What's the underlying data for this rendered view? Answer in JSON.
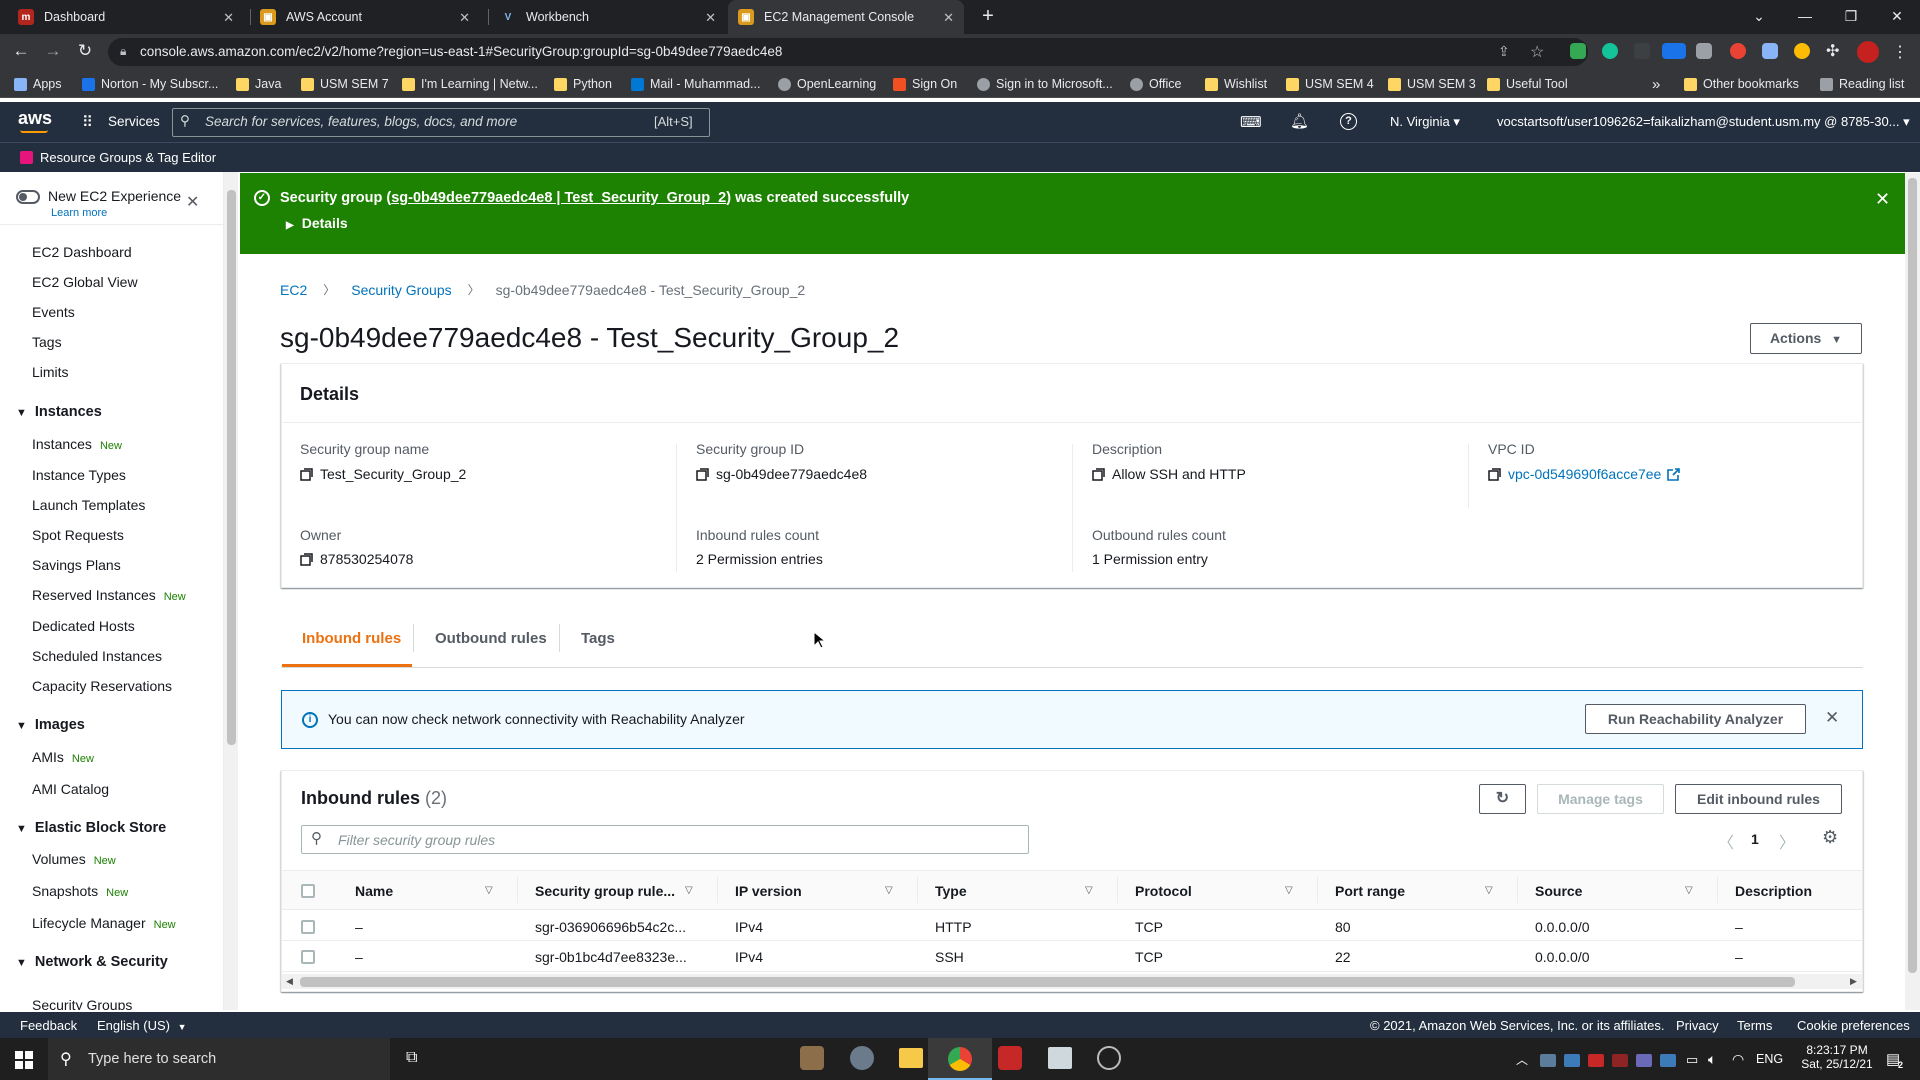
{
  "browser": {
    "tabs": [
      {
        "title": "Dashboard"
      },
      {
        "title": "AWS Account"
      },
      {
        "title": "Workbench"
      },
      {
        "title": "EC2 Management Console"
      }
    ],
    "url": "console.aws.amazon.com/ec2/v2/home?region=us-east-1#SecurityGroup:groupId=sg-0b49dee779aedc4e8",
    "bookmarks": [
      "Apps",
      "Norton - My Subscr...",
      "Java",
      "USM SEM 7",
      "I'm Learning | Netw...",
      "Python",
      "Mail - Muhammad...",
      "OpenLearning",
      "Sign On",
      "Sign in to Microsoft...",
      "Office",
      "Wishlist",
      "USM SEM 4",
      "USM SEM 3",
      "Useful Tool"
    ],
    "other_bookmarks": "Other bookmarks",
    "reading_list": "Reading list",
    "overflow": "»"
  },
  "aws_header": {
    "logo": "aws",
    "services": "Services",
    "search_placeholder": "Search for services, features, blogs, docs, and more",
    "search_shortcut": "[Alt+S]",
    "region": "N. Virginia",
    "account": "vocstartsoft/user1096262=faikalizham@student.usm.my @ 8785-30...",
    "resource_groups": "Resource Groups & Tag Editor"
  },
  "sidebar": {
    "new_experience": "New EC2 Experience",
    "learn_more": "Learn more",
    "top_items": [
      "EC2 Dashboard",
      "EC2 Global View",
      "Events",
      "Tags",
      "Limits"
    ],
    "new_badge": "New",
    "sections": [
      {
        "title": "Instances",
        "items": [
          {
            "label": "Instances",
            "new": true
          },
          {
            "label": "Instance Types"
          },
          {
            "label": "Launch Templates"
          },
          {
            "label": "Spot Requests"
          },
          {
            "label": "Savings Plans"
          },
          {
            "label": "Reserved Instances",
            "new": true
          },
          {
            "label": "Dedicated Hosts"
          },
          {
            "label": "Scheduled Instances"
          },
          {
            "label": "Capacity Reservations"
          }
        ]
      },
      {
        "title": "Images",
        "items": [
          {
            "label": "AMIs",
            "new": true
          },
          {
            "label": "AMI Catalog"
          }
        ]
      },
      {
        "title": "Elastic Block Store",
        "items": [
          {
            "label": "Volumes",
            "new": true
          },
          {
            "label": "Snapshots",
            "new": true
          },
          {
            "label": "Lifecycle Manager",
            "new": true
          }
        ]
      },
      {
        "title": "Network & Security",
        "items": [
          {
            "label": "Security Groups"
          }
        ]
      }
    ]
  },
  "flash": {
    "prefix": "Security group (",
    "link": "sg-0b49dee779aedc4e8 | Test_Security_Group_2",
    "suffix": ") was created successfully",
    "details": "Details"
  },
  "breadcrumb": [
    "EC2",
    "Security Groups",
    "sg-0b49dee779aedc4e8 - Test_Security_Group_2"
  ],
  "page_title": "sg-0b49dee779aedc4e8 - Test_Security_Group_2",
  "actions_label": "Actions",
  "details": {
    "title": "Details",
    "fields": [
      {
        "label": "Security group name",
        "value": "Test_Security_Group_2"
      },
      {
        "label": "Security group ID",
        "value": "sg-0b49dee779aedc4e8"
      },
      {
        "label": "Description",
        "value": "Allow SSH and HTTP"
      },
      {
        "label": "VPC ID",
        "value": "vpc-0d549690f6acce7ee"
      },
      {
        "label": "Owner",
        "value": "878530254078"
      },
      {
        "label": "Inbound rules count",
        "value": "2 Permission entries"
      },
      {
        "label": "Outbound rules count",
        "value": "1 Permission entry"
      }
    ]
  },
  "tabs": [
    "Inbound rules",
    "Outbound rules",
    "Tags"
  ],
  "info": {
    "text": "You can now check network connectivity with Reachability Analyzer",
    "button": "Run Reachability Analyzer"
  },
  "inbound": {
    "title": "Inbound rules",
    "count": "(2)",
    "manage_tags": "Manage tags",
    "edit": "Edit inbound rules",
    "filter_placeholder": "Filter security group rules",
    "page": "1",
    "columns": [
      "Name",
      "Security group rule...",
      "IP version",
      "Type",
      "Protocol",
      "Port range",
      "Source",
      "Description"
    ],
    "rows": [
      [
        "–",
        "sgr-036906696b54c2c...",
        "IPv4",
        "HTTP",
        "TCP",
        "80",
        "0.0.0.0/0",
        "–"
      ],
      [
        "–",
        "sgr-0b1bc4d7ee8323e...",
        "IPv4",
        "SSH",
        "TCP",
        "22",
        "0.0.0.0/0",
        "–"
      ]
    ]
  },
  "footer": {
    "feedback": "Feedback",
    "language": "English (US)",
    "copyright": "© 2021, Amazon Web Services, Inc. or its affiliates.",
    "privacy": "Privacy",
    "terms": "Terms",
    "cookie": "Cookie preferences"
  },
  "taskbar": {
    "search_placeholder": "Type here to search",
    "lang": "ENG",
    "time": "8:23:17 PM",
    "date": "Sat, 25/12/21",
    "notif_count": "2"
  },
  "colors": {
    "aws_navy": "#232f3e",
    "success_green": "#1d8102",
    "link_blue": "#0073bb",
    "active_tab_orange": "#ec7211"
  }
}
